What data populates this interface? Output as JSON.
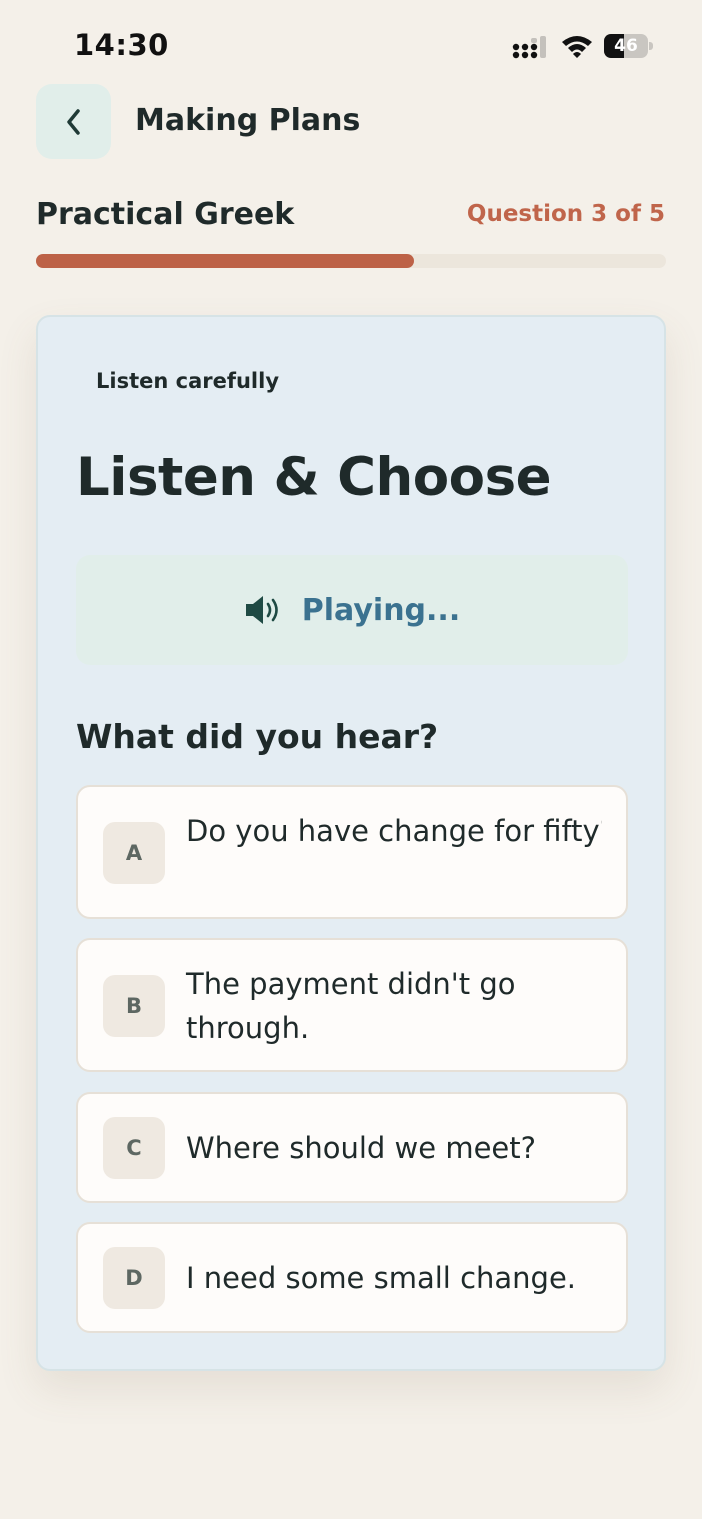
{
  "status_bar": {
    "time": "14:30",
    "battery_level": "46",
    "battery_fraction": 0.46,
    "icons": [
      "signal-icon",
      "wifi-icon",
      "battery-icon"
    ]
  },
  "nav": {
    "back_icon": "chevron-left-icon",
    "title": "Making Plans"
  },
  "lesson": {
    "course": "Practical Greek",
    "counter": "Question 3 of 5",
    "progress_fraction": 0.6
  },
  "card": {
    "instruction": "Listen carefully",
    "title": "Listen & Choose",
    "audio": {
      "icon": "speaker-icon",
      "label": "Playing..."
    },
    "prompt": "What did you hear?",
    "options": [
      {
        "letter": "A",
        "text": "Do you have change for fifty?"
      },
      {
        "letter": "B",
        "text": "The payment didn't go through."
      },
      {
        "letter": "C",
        "text": "Where should we meet?"
      },
      {
        "letter": "D",
        "text": "I need some small change."
      }
    ]
  },
  "colors": {
    "background": "#f4f0e9",
    "accent": "#bd6247",
    "card": "#e4edf3",
    "audio_panel": "#e1eeea",
    "audio_text": "#3b7290",
    "text": "#1f2a2a"
  }
}
